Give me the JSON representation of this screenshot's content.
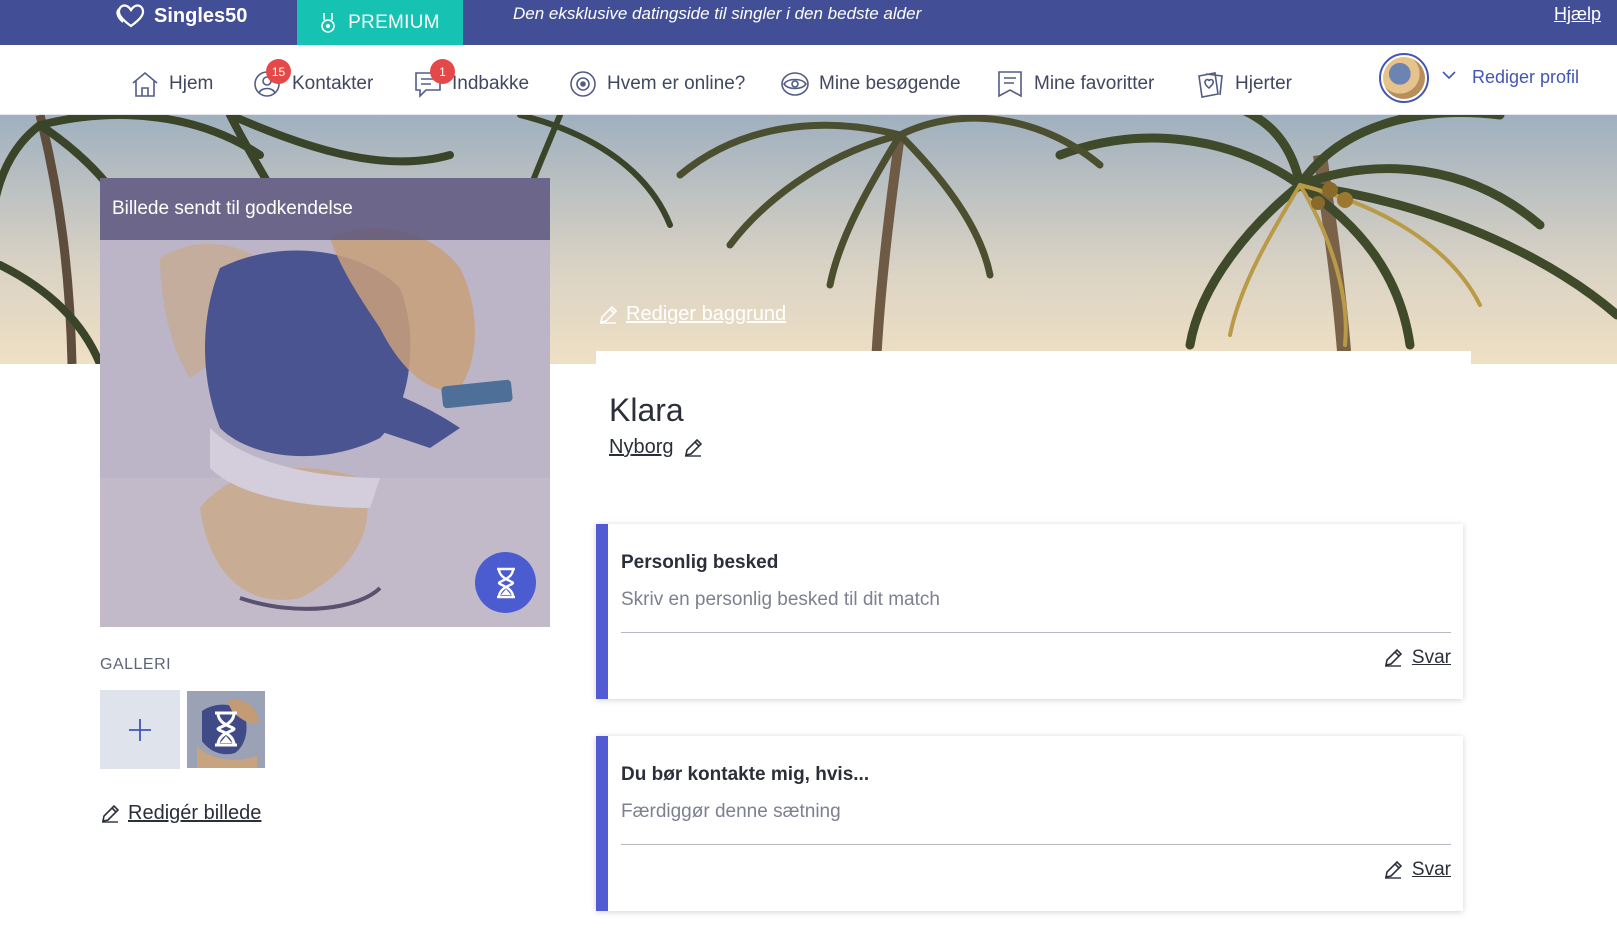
{
  "topbar": {
    "brand": "Singles50",
    "brand_icon": "double-heart-icon",
    "premium_label": "PREMIUM",
    "premium_icon": "medal-icon",
    "tagline": "Den eksklusive datingside til singler i den bedste alder",
    "help_link": "Hjælp"
  },
  "nav": {
    "items": [
      {
        "label": "Hjem",
        "icon": "home-icon"
      },
      {
        "label": "Kontakter",
        "icon": "contacts-icon",
        "badge": "15"
      },
      {
        "label": "Indbakke",
        "icon": "inbox-icon",
        "badge": "1"
      },
      {
        "label": "Hvem er online?",
        "icon": "online-icon"
      },
      {
        "label": "Mine besøgende",
        "icon": "eye-icon"
      },
      {
        "label": "Mine favoritter",
        "icon": "bookmark-icon"
      },
      {
        "label": "Hjerter",
        "icon": "hearts-icon"
      }
    ],
    "edit_profile": "Rediger profil"
  },
  "banner": {
    "edit_background": "Rediger baggrund"
  },
  "photo": {
    "status": "Billede sendt til godkendelse"
  },
  "gallery": {
    "label": "GALLERI",
    "edit_photo": "Redigér billede"
  },
  "profile": {
    "name": "Klara",
    "city": "Nyborg"
  },
  "cards": [
    {
      "title": "Personlig besked",
      "hint": "Skriv en personlig besked til dit match",
      "reply": "Svar"
    },
    {
      "title": "Du bør kontakte mig, hvis...",
      "hint": "Færdiggør denne sætning",
      "reply": "Svar"
    }
  ],
  "colors": {
    "topbar": "#424f96",
    "premium": "#16c2b1",
    "accent": "#525bd3",
    "badge": "#e54848"
  }
}
